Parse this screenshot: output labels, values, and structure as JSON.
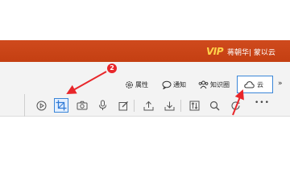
{
  "title_bar": {
    "vip_label": "VIP",
    "user_text": "蒋朝华| 蒙以云",
    "background_color": "#c84418"
  },
  "menu": {
    "items": [
      {
        "label": "属性",
        "icon": "gear-icon"
      },
      {
        "label": "通知",
        "icon": "speech-bubble-icon"
      },
      {
        "label": "知识圈",
        "icon": "people-icon"
      }
    ],
    "cloud": {
      "label": "云",
      "icon": "cloud-icon",
      "accent": "#3a86d8"
    },
    "more_symbol": "»"
  },
  "toolbar": {
    "tools": [
      {
        "icon": "play-circle-icon"
      },
      {
        "icon": "crop-icon",
        "selected": true
      },
      {
        "icon": "camera-icon"
      },
      {
        "icon": "microphone-icon"
      },
      {
        "icon": "edit-icon"
      },
      {
        "icon": "upload-icon"
      },
      {
        "icon": "download-icon"
      },
      {
        "icon": "sort-icon"
      },
      {
        "icon": "search-icon"
      },
      {
        "icon": "refresh-icon"
      }
    ],
    "more_symbol": "•••"
  },
  "annotation": {
    "callout_number": "2",
    "color": "#e8262a"
  }
}
